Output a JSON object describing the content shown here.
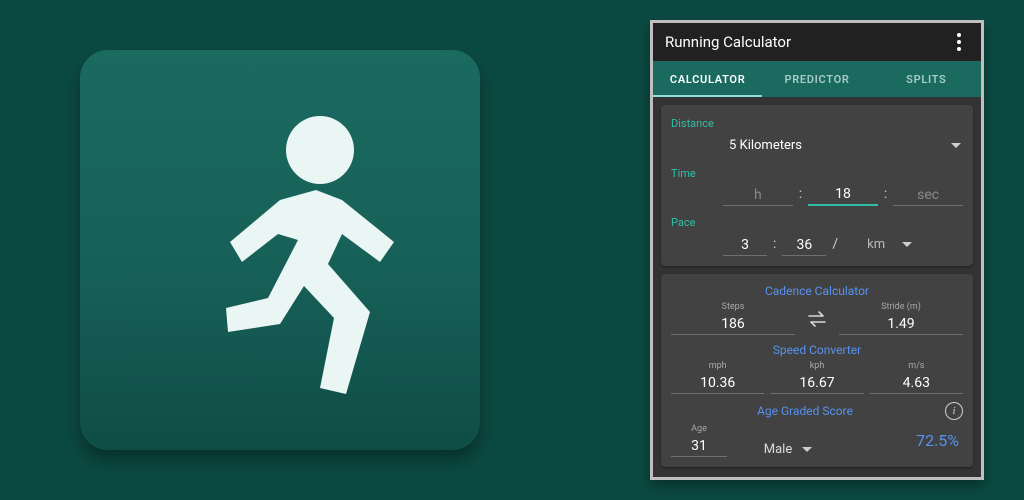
{
  "app": {
    "title": "Running Calculator"
  },
  "tabs": [
    {
      "label": "CALCULATOR",
      "active": true
    },
    {
      "label": "PREDICTOR",
      "active": false
    },
    {
      "label": "SPLITS",
      "active": false
    }
  ],
  "main": {
    "distance": {
      "label": "Distance",
      "selected": "5 Kilometers"
    },
    "time": {
      "label": "Time",
      "h_placeholder": "h",
      "min": "18",
      "sec_placeholder": "sec",
      "colon": ":"
    },
    "pace": {
      "label": "Pace",
      "min": "3",
      "sec": "36",
      "slash": "/",
      "unit": "km"
    }
  },
  "cadence": {
    "title": "Cadence Calculator",
    "steps_label": "Steps",
    "steps": "186",
    "stride_label": "Stride (m)",
    "stride": "1.49"
  },
  "speed": {
    "title": "Speed Converter",
    "mph_label": "mph",
    "mph": "10.36",
    "kph_label": "kph",
    "kph": "16.67",
    "ms_label": "m/s",
    "ms": "4.63"
  },
  "agegrade": {
    "title": "Age Graded Score",
    "age_label": "Age",
    "age": "31",
    "gender": "Male",
    "score": "72.5%"
  }
}
